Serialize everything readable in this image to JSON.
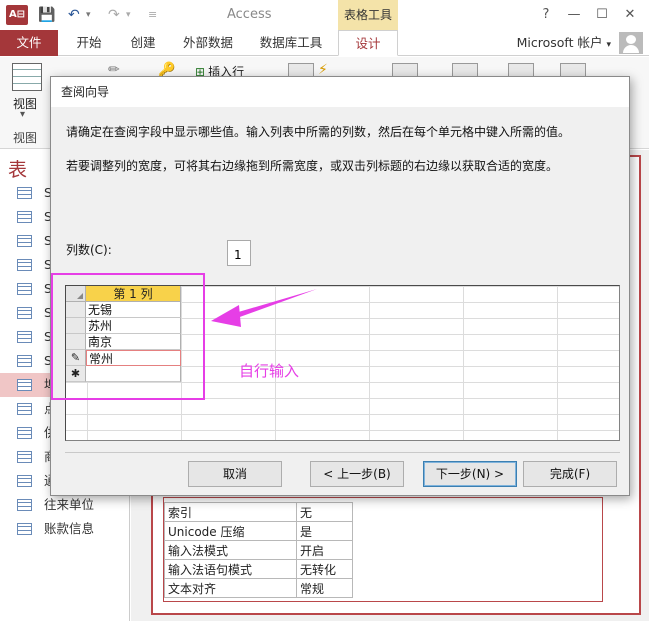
{
  "titlebar": {
    "app_icon": "A⊟",
    "title": "Access",
    "context_tab": "表格工具",
    "help": "?",
    "minimize": "—",
    "restore": "☐",
    "close": "✕"
  },
  "tabs": {
    "file": "文件",
    "home": "开始",
    "create": "创建",
    "external": "外部数据",
    "dbtools": "数据库工具",
    "design": "设计",
    "account": "Microsoft 帐户"
  },
  "ribbon": {
    "view_label": "视图",
    "view_group_label": "视图",
    "insert_row": "插入行"
  },
  "nav": {
    "header": "表",
    "items": [
      {
        "label": "S"
      },
      {
        "label": "S"
      },
      {
        "label": "S"
      },
      {
        "label": "S"
      },
      {
        "label": "S"
      },
      {
        "label": "S"
      },
      {
        "label": "S"
      },
      {
        "label": "S"
      },
      {
        "label": "埠"
      },
      {
        "label": "点"
      },
      {
        "label": "供"
      },
      {
        "label": "商"
      },
      {
        "label": "通"
      },
      {
        "label": "往来单位"
      },
      {
        "label": "账款信息"
      }
    ]
  },
  "properties": [
    {
      "key": "索引",
      "value": "无"
    },
    {
      "key": "Unicode 压缩",
      "value": "是"
    },
    {
      "key": "输入法模式",
      "value": "开启"
    },
    {
      "key": "输入法语句模式",
      "value": "无转化"
    },
    {
      "key": "文本对齐",
      "value": "常规"
    }
  ],
  "dialog": {
    "title": "查阅向导",
    "line1": "请确定在查阅字段中显示哪些值。输入列表中所需的列数，然后在每个单元格中键入所需的值。",
    "line2": "若要调整列的宽度，可将其右边缘拖到所需宽度，或双击列标题的右边缘以获取合适的宽度。",
    "columns_label": "列数(C):",
    "columns_value": "1",
    "grid_header": "第 1 列",
    "rows": [
      "无锡",
      "苏州",
      "南京",
      "常州"
    ],
    "edit_marker": "✎",
    "new_marker": "✱",
    "buttons": {
      "cancel": "取消",
      "back": "< 上一步(B)",
      "next": "下一步(N) >",
      "finish": "完成(F)"
    }
  },
  "annotation": {
    "text": "自行输入",
    "color": "#e63ee6"
  }
}
